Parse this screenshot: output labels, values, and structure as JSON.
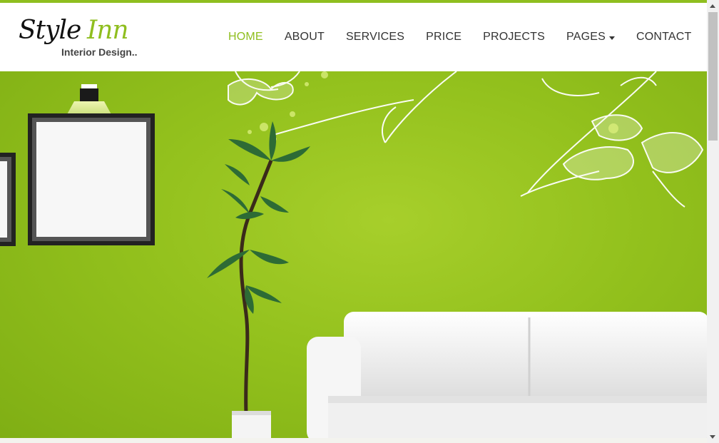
{
  "brand": {
    "logo_main": "Style",
    "logo_accent": "Inn",
    "logo_sub": "Interior Design..",
    "accent_color": "#8fbe1f"
  },
  "nav": {
    "items": [
      {
        "label": "HOME",
        "active": true
      },
      {
        "label": "ABOUT"
      },
      {
        "label": "SERVICES"
      },
      {
        "label": "PRICE"
      },
      {
        "label": "PROJECTS"
      },
      {
        "label": "PAGES",
        "has_dropdown": true,
        "icon": "caret-down-icon"
      },
      {
        "label": "CONTACT"
      }
    ]
  },
  "hero": {
    "background_color": "#93c11d",
    "illustration": [
      "wall-lamp-icon",
      "picture-frame",
      "potted-plant",
      "white-sofa",
      "floral-decal"
    ]
  }
}
